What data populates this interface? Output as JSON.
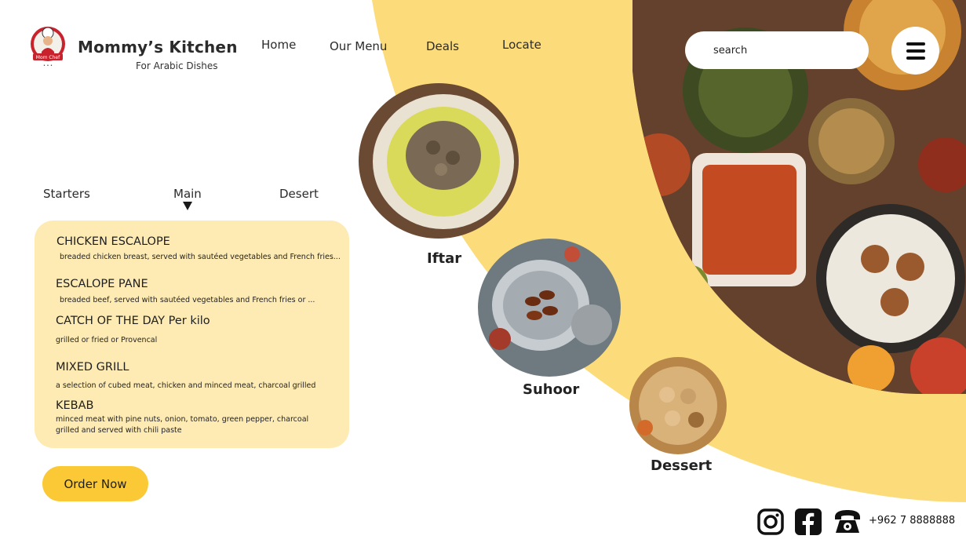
{
  "brand": {
    "title": "Mommy’s Kitchen",
    "subtitle": "For Arabic Dishes",
    "logo_text": "Mom Chef"
  },
  "nav": {
    "items": [
      {
        "label": "Home"
      },
      {
        "label": "Our Menu"
      },
      {
        "label": "Deals"
      },
      {
        "label": "Locate"
      }
    ]
  },
  "search": {
    "placeholder": "search"
  },
  "menu_icon": "hamburger-icon",
  "tabs": [
    {
      "label": "Starters"
    },
    {
      "label": "Main"
    },
    {
      "label": "Desert"
    }
  ],
  "menu": {
    "items": [
      {
        "name": "CHICKEN ESCALOPE",
        "desc": "breaded chicken breast, served with sautéed vegetables and French fries..."
      },
      {
        "name": "ESCALOPE PANE",
        "desc": "breaded beef, served with sautéed vegetables and French fries or ..."
      },
      {
        "name": "CATCH OF THE DAY Per kilo",
        "desc": "grilled or fried or Provencal"
      },
      {
        "name": "MIXED GRILL",
        "desc": "a selection of cubed meat, chicken and minced meat, charcoal grilled"
      },
      {
        "name": "KEBAB",
        "desc": "minced meat with pine nuts, onion, tomato, green pepper, charcoal grilled and served with chili paste"
      }
    ]
  },
  "order_button": {
    "label": "Order Now"
  },
  "categories": [
    {
      "label": "Iftar"
    },
    {
      "label": "Suhoor"
    },
    {
      "label": "Dessert"
    }
  ],
  "footer": {
    "icons": [
      "instagram-icon",
      "facebook-icon",
      "telephone-icon"
    ],
    "phone": "+962 7 8888888"
  },
  "colors": {
    "accent_yellow": "#fcdb7a",
    "card_bg": "#feebb4",
    "button_bg": "#fbc935"
  }
}
